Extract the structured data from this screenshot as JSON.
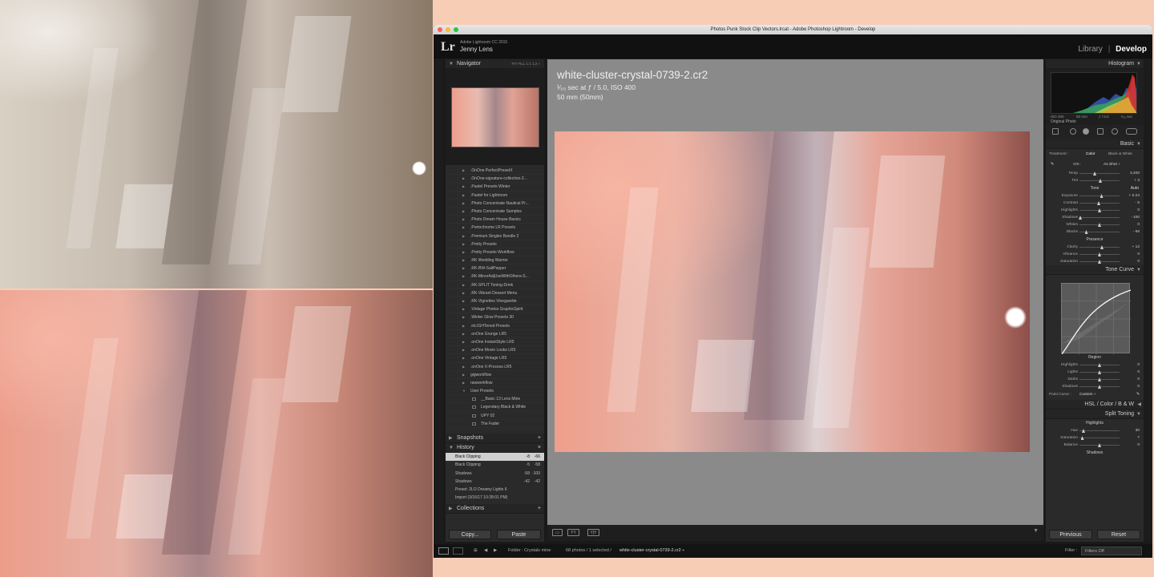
{
  "window": {
    "title": "Photos Punk Stock Clip Vectors.lrcat - Adobe Photoshop Lightroom - Develop"
  },
  "identity": {
    "app": "Adobe Lightroom CC 2015",
    "user": "Jenny Lens",
    "logo": "Lr"
  },
  "modules": {
    "library": "Library",
    "separator": "|",
    "develop": "Develop"
  },
  "navigator": {
    "title": "Navigator",
    "zoom": "FIT   FILL   1:1   1:2 ÷"
  },
  "presets": [
    {
      "label": ".OnOne PerfectPresetX",
      "child": false
    },
    {
      "label": ".OnOne-signature-collection-2...",
      "child": false
    },
    {
      "label": ".Pastel Presets Winter",
      "child": false
    },
    {
      "label": ".Pastel for Lightroom",
      "child": false
    },
    {
      "label": ".Photo Concentrate Nautical Pr...",
      "child": false
    },
    {
      "label": ".Photo Concentrate Samples",
      "child": false
    },
    {
      "label": ".Photo Dream House Basics",
      "child": false
    },
    {
      "label": ".Portochrome LR Presets",
      "child": false
    },
    {
      "label": ".Premium Singles Bundle 2",
      "child": false
    },
    {
      "label": ".Pretty Presets",
      "child": false
    },
    {
      "label": ".Pretty Presets Workflow",
      "child": false
    },
    {
      "label": ".RK Wedding Warrior",
      "child": false
    },
    {
      "label": ".RK-BW-SaltPepper",
      "child": false
    },
    {
      "label": ".RK-MinorAdjUseWithOthers-S...",
      "child": false
    },
    {
      "label": ".RK-SPLIT Toning-Drink",
      "child": false
    },
    {
      "label": ".RK-Vibrant Dessert Menu",
      "child": false
    },
    {
      "label": ".RK-Vignettes Vinegarette",
      "child": false
    },
    {
      "label": ".Vintage Photos GraphicSpirit",
      "child": false
    },
    {
      "label": ".Winter Glow Presets 30",
      "child": false
    },
    {
      "label": ".inLIGHTened Presets",
      "child": false
    },
    {
      "label": ".onOne Grunge LR5",
      "child": false
    },
    {
      "label": ".onOne InstantStyle LR5",
      "child": false
    },
    {
      "label": ".onOne Movie Looks LR5",
      "child": false
    },
    {
      "label": ".onOne Vintage LR5",
      "child": false
    },
    {
      "label": ".onOne X-Process LR5",
      "child": false
    },
    {
      "label": "gigworkflow",
      "child": false
    },
    {
      "label": "rawworkflow",
      "child": false
    },
    {
      "label": "User Presets",
      "child": false,
      "open": true
    },
    {
      "label": "__Basic 13 Lens Mine",
      "child": true
    },
    {
      "label": "Legendary Black & White",
      "child": true
    },
    {
      "label": "UPY 02",
      "child": true
    },
    {
      "label": "The Fader",
      "child": true
    }
  ],
  "snapshots": {
    "title": "Snapshots",
    "add": "+"
  },
  "history": {
    "title": "History",
    "close": "×",
    "items": [
      {
        "label": "Black Clipping",
        "v1": "-8",
        "v2": "-66",
        "selected": true
      },
      {
        "label": "Black Clipping",
        "v1": "-5",
        "v2": "-58",
        "selected": false
      },
      {
        "label": "Shadows",
        "v1": "-58",
        "v2": "-100",
        "selected": false
      },
      {
        "label": "Shadows",
        "v1": "-42",
        "v2": "-42",
        "selected": false
      },
      {
        "label": "Preset: 2LO Dreamy Lights 6",
        "v1": "",
        "v2": "",
        "selected": false
      },
      {
        "label": "Import (3/16/17 10:28:01 PM)",
        "v1": "",
        "v2": "",
        "selected": false
      }
    ]
  },
  "collections": {
    "title": "Collections",
    "add": "+"
  },
  "left_buttons": {
    "copy": "Copy...",
    "paste": "Paste"
  },
  "photo_info": {
    "filename": "white-cluster-crystal-0739-2.cr2",
    "exif_line1": "¹⁄₅₀ sec at ƒ / 5.0, ISO 400",
    "exif_line2": "50 mm (50mm)"
  },
  "histogram": {
    "title": "Histogram",
    "iso": "ISO 400",
    "focal": "50 mm",
    "aperture": "ƒ / 5.0",
    "shutter": "¹⁄₅₀ sec",
    "original": "Original Photo"
  },
  "basic": {
    "title": "Basic",
    "treatment_label": "Treatment :",
    "color": "Color",
    "bw": "Black & White",
    "wb_label": "WB :",
    "wb_value": "As Shot ÷",
    "tone_label": "Tone",
    "auto": "Auto",
    "presence_label": "Presence",
    "sliders": [
      {
        "label": "Temp",
        "value": "3,400",
        "pos": 0.38
      },
      {
        "label": "Tint",
        "value": "+ 3",
        "pos": 0.52
      },
      {
        "label": "Exposure",
        "value": "+ 0.24",
        "pos": 0.55
      },
      {
        "label": "Contrast",
        "value": "- 5",
        "pos": 0.48
      },
      {
        "label": "Highlights",
        "value": "0",
        "pos": 0.5
      },
      {
        "label": "Shadows",
        "value": "- 100",
        "pos": 0.02
      },
      {
        "label": "Whites",
        "value": "0",
        "pos": 0.5
      },
      {
        "label": "Blacks",
        "value": "- 66",
        "pos": 0.17
      },
      {
        "label": "Clarity",
        "value": "+ 12",
        "pos": 0.56
      },
      {
        "label": "Vibrance",
        "value": "0",
        "pos": 0.5
      },
      {
        "label": "Saturation",
        "value": "0",
        "pos": 0.5
      }
    ]
  },
  "tone_curve": {
    "title": "Tone Curve",
    "region": "Region",
    "point_curve_label": "Point Curve :",
    "point_curve_value": "Custom ÷",
    "sliders": [
      {
        "label": "Highlights",
        "value": "0",
        "pos": 0.5
      },
      {
        "label": "Lights",
        "value": "0",
        "pos": 0.5
      },
      {
        "label": "Darks",
        "value": "0",
        "pos": 0.5
      },
      {
        "label": "Shadows",
        "value": "0",
        "pos": 0.5
      }
    ]
  },
  "hsl": {
    "label": "HSL  /  Color  /  B & W"
  },
  "split_toning": {
    "title": "Split Toning",
    "highlights": "Highlights",
    "balance": "Balance",
    "shadows": "Shadows",
    "sliders": [
      {
        "label": "Hue",
        "value": "30",
        "pos": 0.1
      },
      {
        "label": "Saturation",
        "value": "7",
        "pos": 0.07
      }
    ],
    "balance_slider": {
      "label": "Balance",
      "value": "0",
      "pos": 0.5
    }
  },
  "right_buttons": {
    "previous": "Previous",
    "reset": "Reset"
  },
  "filmstrip": {
    "folder": "Folder : Crystals mine",
    "count": "68 photos / 1 selected /",
    "file": "white-cluster-crystal-0739-2.cr2 ÷",
    "filter_label": "Filter :",
    "filter_value": "Filters Off"
  },
  "colors": {
    "accent_bg": "#f7cdb6",
    "panel": "#2a2a2a",
    "canvas": "#8a8a8a"
  }
}
